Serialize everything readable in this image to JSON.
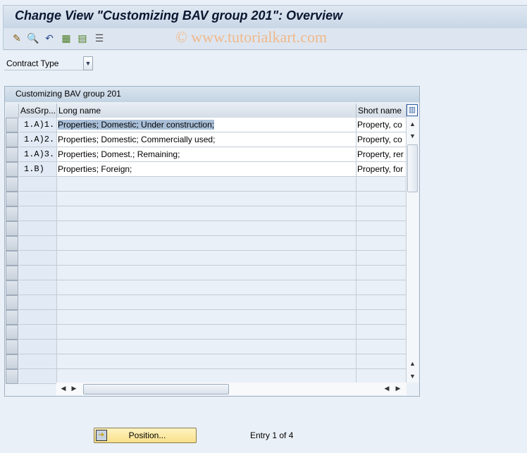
{
  "title": "Change View \"Customizing BAV group 201\": Overview",
  "watermark": "© www.tutorialkart.com",
  "toolbar": {
    "icons": [
      "pencil-glasses-icon",
      "display-icon",
      "undo-icon",
      "select-all-icon",
      "select-block-icon",
      "deselect-all-icon"
    ]
  },
  "filter": {
    "label": "Contract Type"
  },
  "table": {
    "title": "Customizing BAV group 201",
    "columns": [
      "AssGrp...",
      "Long name",
      "Short name"
    ],
    "rows": [
      {
        "assgrp": "1.A)1.",
        "long": "Properties; Domestic; Under construction;",
        "short": "Property, co"
      },
      {
        "assgrp": "1.A)2.",
        "long": "Properties; Domestic; Commercially used;",
        "short": "Property, co"
      },
      {
        "assgrp": "1.A)3.",
        "long": "Properties; Domest.; Remaining;",
        "short": "Property, rer"
      },
      {
        "assgrp": "1.B)",
        "long": "Properties; Foreign;",
        "short": "Property, for"
      }
    ]
  },
  "footer": {
    "position_label": "Position...",
    "entry_text": "Entry 1 of 4"
  }
}
